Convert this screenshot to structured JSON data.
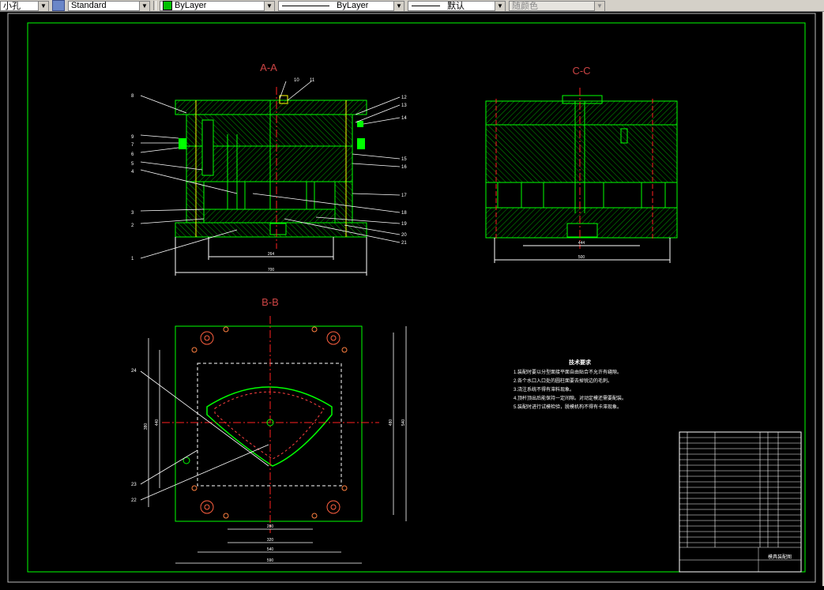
{
  "toolbar": {
    "text_style": "小孔",
    "dim_style": "Standard",
    "layer": "ByLayer",
    "linetype": "ByLayer",
    "lineweight": "默认",
    "plotstyle": "随颜色",
    "layer_color": "#00c000"
  },
  "drawing": {
    "view_aa_title": "A-A",
    "view_cc_title": "C-C",
    "view_bb_title": "B-B",
    "frame_color": "#00ff00",
    "hatch_color": "#00a000",
    "centerline_color": "#ff2020",
    "dim_color": "#ffffff",
    "text_color": "#ffffff",
    "aa_dims": {
      "inner_width": "264",
      "overall_width": "700"
    },
    "cc_dims": {
      "inner_width": "444",
      "overall_width": "500"
    },
    "bb_dims": {
      "w1": "280",
      "w2": "320",
      "w3": "540",
      "w4": "590",
      "h1": "380",
      "h2": "440",
      "h3": "480",
      "h4": "540"
    },
    "aa_labels_left": [
      "8",
      "9",
      "7",
      "6",
      "5",
      "4",
      "3",
      "2",
      "1"
    ],
    "aa_labels_top": [
      "10",
      "11"
    ],
    "aa_labels_right": [
      "12",
      "13",
      "14",
      "15",
      "16",
      "17",
      "18",
      "19",
      "20",
      "21"
    ],
    "bb_labels": [
      "24",
      "23",
      "22"
    ],
    "notes": {
      "title": "技术要求",
      "items": [
        "1.装配时要以分型面接平面自由贴合不允许有缝隙。",
        "2.各个水口入口处的圆柱面要去掉锐边的毛刺。",
        "3.浇注系统不得有滞料现象。",
        "4.顶杆顶出后能保持一定间隙。对动定模还需要配装。",
        "5.装配时进行试模检验，脱模机构不得有卡滞现象。"
      ]
    },
    "title_block": {
      "name": "模具装配图"
    }
  }
}
